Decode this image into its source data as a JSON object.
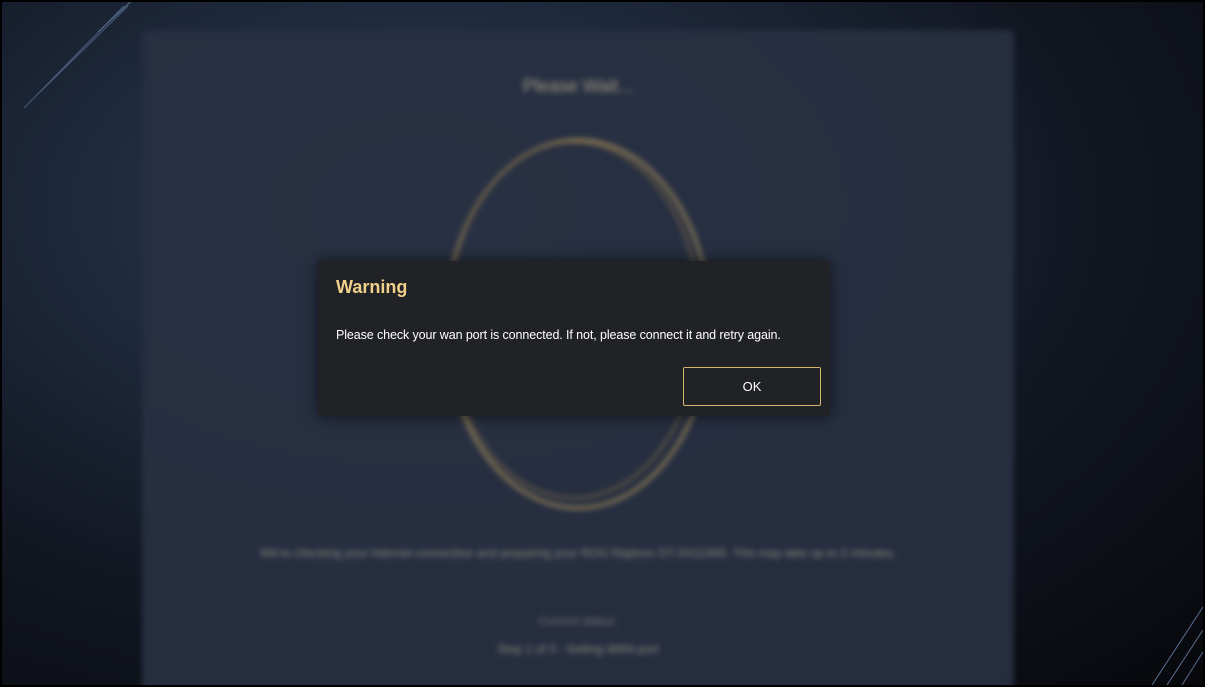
{
  "background": {
    "title": "Please Wait...",
    "description": "We're checking your Internet connection and preparing your ROG Rapture GT-AX11000. This may take up to 2 minutes.",
    "status_label": "Current status:",
    "status_value": "Step 1 of 3 - Setting WAN port"
  },
  "dialog": {
    "title": "Warning",
    "message": "Please check your wan port is connected. If not, please connect it and retry again.",
    "ok_label": "OK"
  },
  "colors": {
    "accent_gold": "#d6b46e",
    "title_gold": "#f1d08a",
    "dialog_bg": "#202226"
  }
}
